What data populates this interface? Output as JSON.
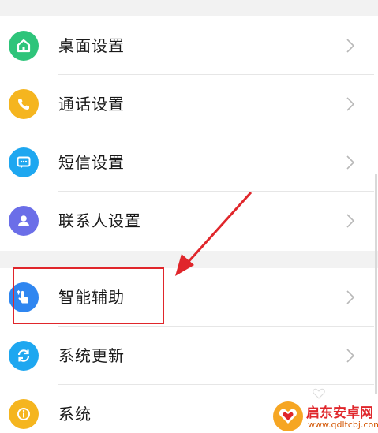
{
  "settings": {
    "items": [
      {
        "label": "桌面设置",
        "icon": "home-icon",
        "color": "#2ec47a"
      },
      {
        "label": "通话设置",
        "icon": "phone-icon",
        "color": "#f5b51f"
      },
      {
        "label": "短信设置",
        "icon": "message-icon",
        "color": "#1ea7f0"
      },
      {
        "label": "联系人设置",
        "icon": "contact-icon",
        "color": "#6b6ee8"
      },
      {
        "label": "智能辅助",
        "icon": "gesture-icon",
        "color": "#2f86f0"
      },
      {
        "label": "系统更新",
        "icon": "refresh-icon",
        "color": "#1ea7f0"
      },
      {
        "label": "系统",
        "icon": "info-icon",
        "color": "#f5b51f"
      }
    ]
  },
  "annotation": {
    "highlight_color": "#e0262b",
    "target": "智能辅助"
  },
  "watermark": {
    "title": "启东安卓网",
    "url": "www.qdltcbj.com",
    "logo_color": "#f6a623"
  }
}
